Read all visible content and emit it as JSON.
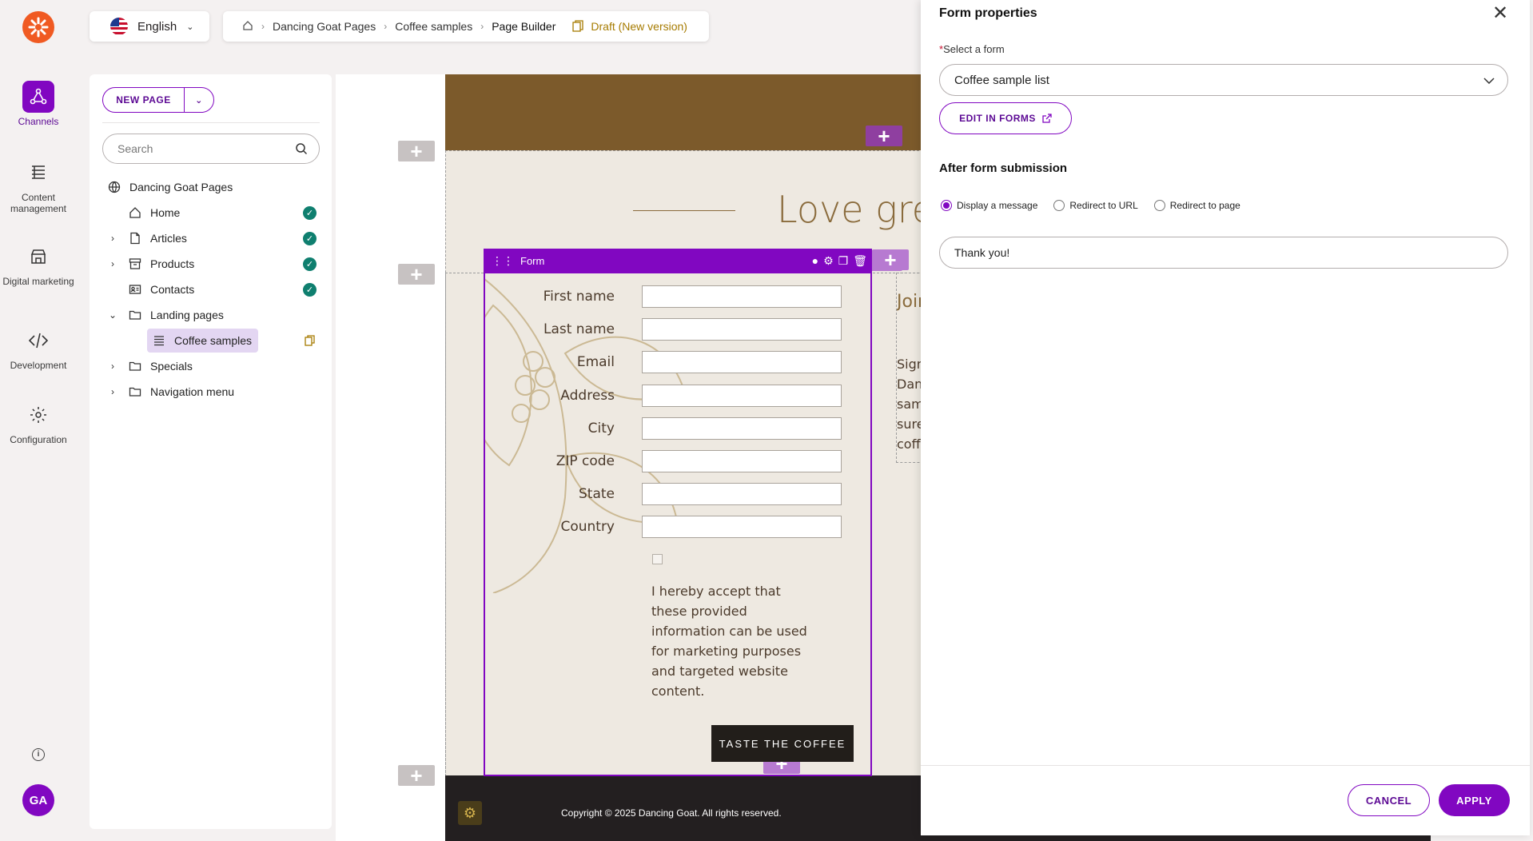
{
  "rail": {
    "items": [
      {
        "label": "Channels"
      },
      {
        "label": "Content management"
      },
      {
        "label": "Digital marketing"
      },
      {
        "label": "Development"
      },
      {
        "label": "Configuration"
      }
    ],
    "avatar_initials": "GA"
  },
  "topbar": {
    "language": "English",
    "breadcrumbs": [
      "Dancing Goat Pages",
      "Coffee samples",
      "Page Builder"
    ],
    "status": "Draft (New version)"
  },
  "tree": {
    "new_page_label": "NEW PAGE",
    "search_placeholder": "Search",
    "root": "Dancing Goat Pages",
    "items": [
      {
        "label": "Home"
      },
      {
        "label": "Articles"
      },
      {
        "label": "Products"
      },
      {
        "label": "Contacts"
      },
      {
        "label": "Landing pages"
      },
      {
        "label": "Coffee samples"
      },
      {
        "label": "Specials"
      },
      {
        "label": "Navigation menu"
      }
    ]
  },
  "canvas": {
    "headline": "Love great coffee",
    "form_widget_label": "Form",
    "fields": [
      "First name",
      "Last name",
      "Email",
      "Address",
      "City",
      "ZIP code",
      "State",
      "Country"
    ],
    "consent_text": "I hereby accept that these provided information can be used for marketing purposes and targeted website content.",
    "submit_label": "TASTE THE COFFEE",
    "side_text_title": "Join us from",
    "side_text_body": "Sign Dan sam sure coff",
    "footer_copyright": "Copyright © 2025 Dancing Goat. All rights reserved."
  },
  "drawer": {
    "title": "Form properties",
    "select_label": "Select a form",
    "selected_form": "Coffee sample list",
    "edit_in_forms": "EDIT IN FORMS",
    "after_submission_title": "After form submission",
    "radio_options": [
      "Display a message",
      "Redirect to URL",
      "Redirect to page"
    ],
    "selected_option": "Display a message",
    "message_value": "Thank you!",
    "cancel_label": "CANCEL",
    "apply_label": "APPLY"
  },
  "colors": {
    "accent": "#8107c1",
    "status_ok": "#0f7f6f",
    "draft": "#a67b00",
    "hero": "#7c5a2b"
  }
}
